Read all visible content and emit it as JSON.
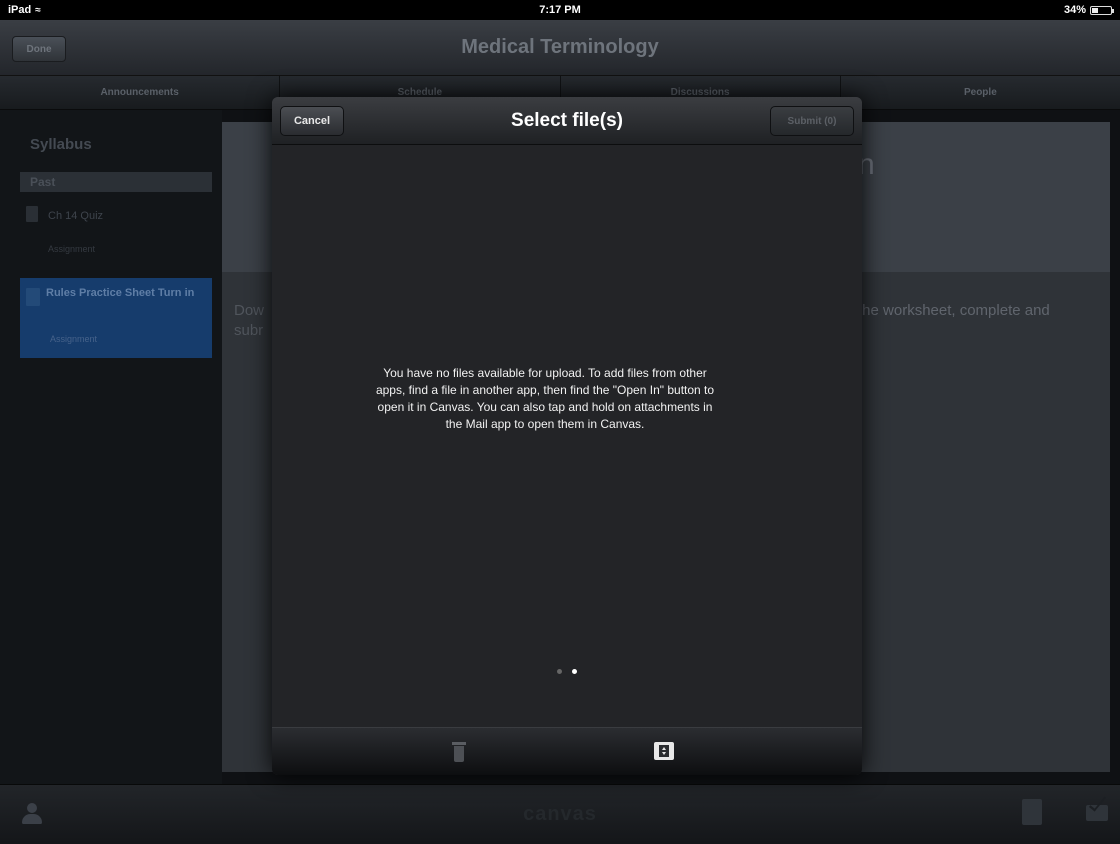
{
  "status": {
    "device": "iPad",
    "time": "7:17 PM",
    "battery": "34%",
    "battery_level": 0.34
  },
  "nav": {
    "title": "Medical Terminology",
    "done_label": "Done"
  },
  "tabs": [
    "Announcements",
    "Schedule",
    "Discussions",
    "People"
  ],
  "sidebar": {
    "heading": "Syllabus",
    "section": "Past",
    "items": [
      {
        "name": "Ch 14 Quiz",
        "sub": "Assignment"
      },
      {
        "name": "Rules Practice Sheet Turn in",
        "sub": "Assignment"
      }
    ]
  },
  "content": {
    "title_fragment": "n",
    "body_left_line1": "Dow",
    "body_left_line2": "subr",
    "body_right": "the worksheet, complete and"
  },
  "modal": {
    "title": "Select file(s)",
    "cancel_label": "Cancel",
    "submit_label": "Submit (0)",
    "message": "You have no files available for upload. To add files from other apps, find a file in another app, then find the \"Open In\" button to open it in Canvas. You can also tap and hold on attachments in the Mail app to open them in Canvas.",
    "page_count": 2,
    "active_page": 2,
    "footer_icons": [
      "trash-icon",
      "frame-icon"
    ]
  },
  "bottombar": {
    "brand": "canvas",
    "icons": [
      "person-icon",
      "document-icon",
      "mail-icon"
    ]
  }
}
